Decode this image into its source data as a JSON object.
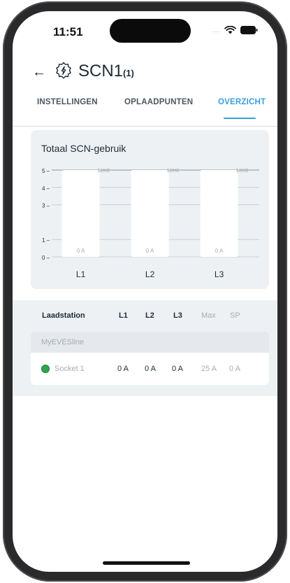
{
  "status_bar": {
    "time": "11:51",
    "signal_dots": "....",
    "wifi_icon": "wifi-icon",
    "battery_icon": "battery-icon"
  },
  "header": {
    "back_icon": "arrow-left-icon",
    "station_icon": "charging-station-icon",
    "title": "SCN1",
    "count": "(1)"
  },
  "tabs": [
    {
      "label": "INSTELLINGEN",
      "active": false
    },
    {
      "label": "OPLAADPUNTEN",
      "active": false
    },
    {
      "label": "OVERZICHT",
      "active": true
    }
  ],
  "colors": {
    "accent": "#3aa0da",
    "card_bg": "#eef1f4",
    "status_ok": "#2ea44f",
    "text": "#1d2b36"
  },
  "chart_data": {
    "type": "bar",
    "title": "Totaal SCN-gebruik",
    "categories": [
      "L1",
      "L2",
      "L3"
    ],
    "values": [
      0,
      0,
      0
    ],
    "capacity": [
      5,
      5,
      5
    ],
    "value_labels": [
      "0 A",
      "0 A",
      "0 A"
    ],
    "limit_label": "Limit",
    "limit_value": 5,
    "yticks": [
      "0",
      "1",
      "3",
      "4",
      "5"
    ],
    "ylim": [
      0,
      5
    ],
    "grid": true
  },
  "table": {
    "headers": [
      "Laadstation",
      "L1",
      "L2",
      "L3",
      "Max",
      "SP"
    ],
    "group": "MyEVESline",
    "rows": [
      {
        "name": "Socket 1",
        "status": "online",
        "l1": "0 A",
        "l2": "0 A",
        "l3": "0 A",
        "max": "25 A",
        "sp": "0 A"
      }
    ]
  }
}
